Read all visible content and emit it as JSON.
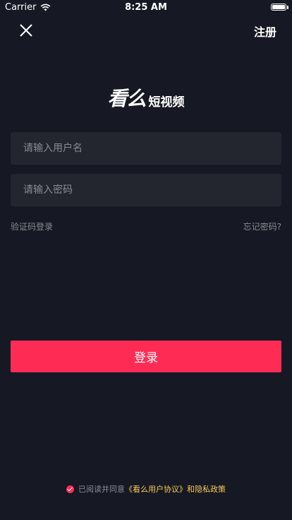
{
  "status_bar": {
    "carrier": "Carrier",
    "time": "8:25 AM"
  },
  "header": {
    "register_label": "注册",
    "close_icon": "close-icon"
  },
  "logo": {
    "main": "看么",
    "sub": "短视频"
  },
  "form": {
    "username_placeholder": "请输入用户名",
    "password_placeholder": "请输入密码"
  },
  "links": {
    "sms_login": "验证码登录",
    "forgot_password": "忘记密码?"
  },
  "login_button": "登录",
  "agreement": {
    "prefix": "已阅读并同意",
    "user_agreement": "《看么用户协议》",
    "conjunction": "和",
    "privacy": "隐私政策"
  },
  "colors": {
    "background": "#161823",
    "input_bg": "#23252f",
    "accent": "#fe2c55",
    "agreement_highlight": "#f5c95b"
  }
}
